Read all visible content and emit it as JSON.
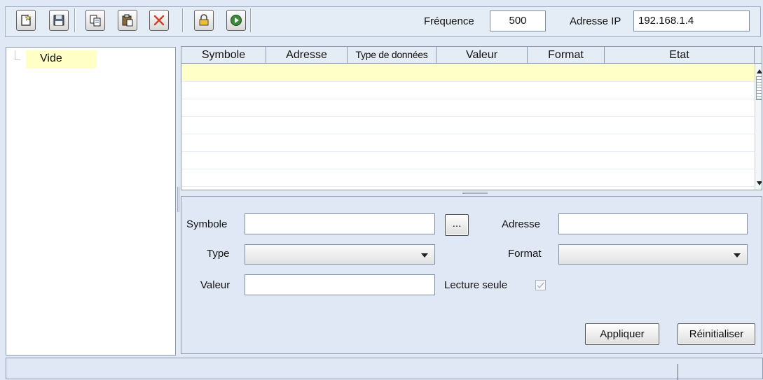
{
  "toolbar": {
    "buttons": [
      {
        "name": "new-icon"
      },
      {
        "name": "save-icon"
      },
      {
        "name": "copy-icon"
      },
      {
        "name": "paste-icon"
      },
      {
        "name": "delete-icon"
      },
      {
        "name": "lock-icon"
      },
      {
        "name": "run-icon"
      }
    ],
    "frequency_label": "Fréquence",
    "frequency_value": "500",
    "ip_label": "Adresse IP",
    "ip_value": "192.168.1.4"
  },
  "tree": {
    "items": [
      {
        "label": "Vide"
      }
    ]
  },
  "grid": {
    "columns": [
      "Symbole",
      "Adresse",
      "Type de données",
      "Valeur",
      "Format",
      "Etat"
    ],
    "rows": []
  },
  "form": {
    "symbol_label": "Symbole",
    "symbol_value": "",
    "browse_label": "...",
    "address_label": "Adresse",
    "address_value": "",
    "type_label": "Type",
    "type_value": "",
    "format_label": "Format",
    "format_value": "",
    "value_label": "Valeur",
    "value_value": "",
    "readonly_label": "Lecture seule",
    "readonly_checked": true,
    "apply_label": "Appliquer",
    "reset_label": "Réinitialiser"
  },
  "colors": {
    "background": "#dfe8f4",
    "selected_row": "#ffffc8",
    "border": "#8a9aaf"
  }
}
